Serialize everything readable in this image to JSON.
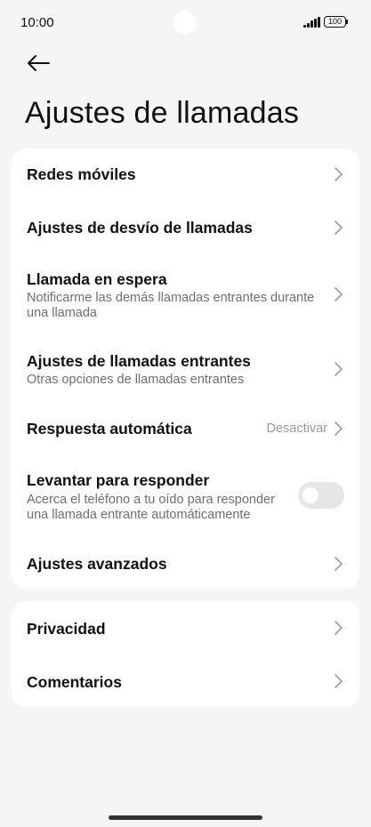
{
  "status_bar": {
    "time": "10:00",
    "battery": "100",
    "icons": [
      "signal-icon",
      "battery-icon"
    ]
  },
  "header": {
    "back_icon": "arrow-left-icon",
    "title": "Ajustes de llamadas"
  },
  "card_main": [
    {
      "title": "Redes móviles"
    },
    {
      "title": "Ajustes de desvío de llamadas"
    },
    {
      "title": "Llamada en espera",
      "subtitle": "Notificarme las demás llamadas entrantes durante una llamada"
    },
    {
      "title": "Ajustes de llamadas entrantes",
      "subtitle": "Otras opciones de llamadas entrantes"
    },
    {
      "title": "Respuesta automática",
      "value": "Desactivar"
    },
    {
      "title": "Levantar para responder",
      "subtitle": "Acerca el teléfono a tu oído para responder una llamada entrante automáticamente",
      "toggle": false
    },
    {
      "title": "Ajustes avanzados"
    }
  ],
  "card_secondary": [
    {
      "title": "Privacidad"
    },
    {
      "title": "Comentarios"
    }
  ],
  "colors": {
    "background": "#f5f5f5",
    "card": "#ffffff",
    "title_text": "#111111",
    "subtitle_text": "#6f6f6f",
    "toggle_off": "#e6e6e6",
    "chevron": "#9a9a9a"
  }
}
